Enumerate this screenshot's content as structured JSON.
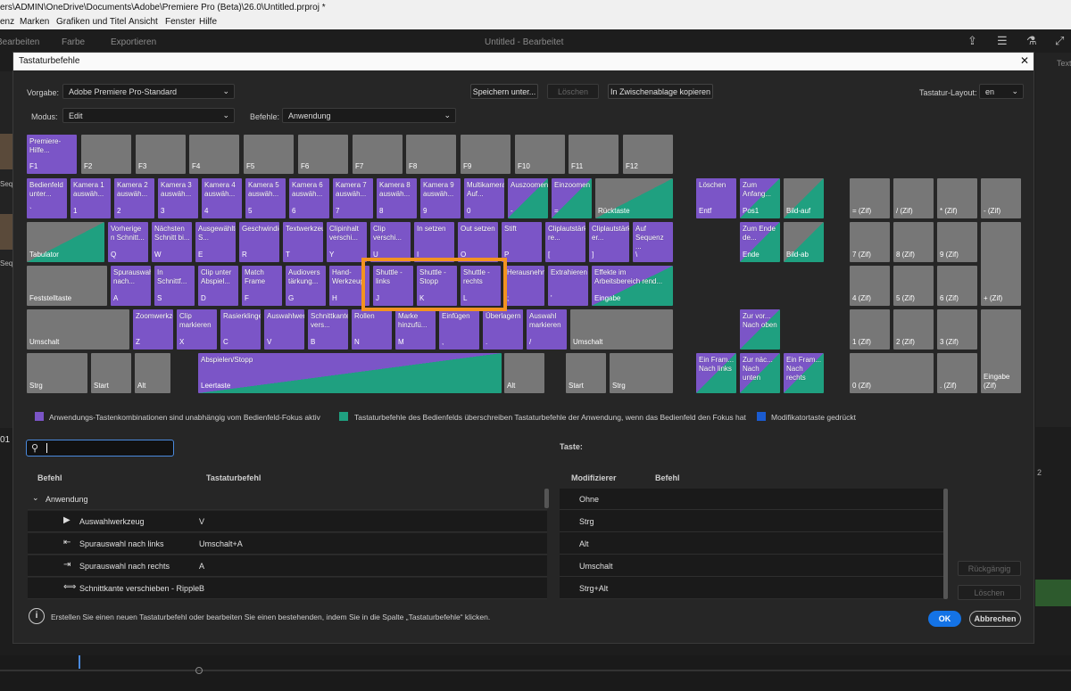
{
  "titlebar": {
    "text": "ers\\ADMIN\\OneDrive\\Documents\\Adobe\\Premiere Pro (Beta)\\26.0\\Untitled.prproj *"
  },
  "menubar": {
    "items": [
      "enz",
      "Marken",
      "Grafiken und Titel",
      "Ansicht",
      "Fenster",
      "Hilfe"
    ]
  },
  "workspace": {
    "tabs": [
      "Bearbeiten",
      "Farbe",
      "Exportieren"
    ],
    "project_title": "Untitled - Bearbeitet",
    "right_text": "Text"
  },
  "dialog": {
    "title": "Tastaturbefehle",
    "close": "✕"
  },
  "controls": {
    "preset_label": "Vorgabe:",
    "preset_value": "Adobe Premiere Pro-Standard",
    "save_btn": "Speichern unter...",
    "delete_btn": "Löschen",
    "clipboard_btn": "In Zwischenablage kopieren",
    "layout_label": "Tastatur-Layout:",
    "layout_value": "en",
    "mode_label": "Modus:",
    "mode_value": "Edit",
    "commands_label": "Befehle:",
    "commands_value": "Anwendung"
  },
  "keyboard": {
    "keys": [
      {
        "cmd": "Premiere-Hilfe...",
        "lab": "F1",
        "c": "p"
      },
      {
        "cmd": "",
        "lab": "F2",
        "c": ""
      },
      {
        "cmd": "",
        "lab": "F3",
        "c": ""
      },
      {
        "cmd": "",
        "lab": "F4",
        "c": ""
      },
      {
        "cmd": "",
        "lab": "F5",
        "c": ""
      },
      {
        "cmd": "",
        "lab": "F6",
        "c": ""
      },
      {
        "cmd": "",
        "lab": "F7",
        "c": ""
      },
      {
        "cmd": "",
        "lab": "F8",
        "c": ""
      },
      {
        "cmd": "",
        "lab": "F9",
        "c": ""
      },
      {
        "cmd": "",
        "lab": "F10",
        "c": ""
      },
      {
        "cmd": "",
        "lab": "F11",
        "c": ""
      },
      {
        "cmd": "",
        "lab": "F12",
        "c": ""
      },
      {
        "cmd": "Bedienfeld unter...",
        "lab": "`",
        "c": "p"
      },
      {
        "cmd": "Kamera 1 auswäh...",
        "lab": "1",
        "c": "p"
      },
      {
        "cmd": "Kamera 2 auswäh...",
        "lab": "2",
        "c": "p"
      },
      {
        "cmd": "Kamera 3 auswäh...",
        "lab": "3",
        "c": "p"
      },
      {
        "cmd": "Kamera 4 auswäh...",
        "lab": "4",
        "c": "p"
      },
      {
        "cmd": "Kamera 5 auswäh...",
        "lab": "5",
        "c": "p"
      },
      {
        "cmd": "Kamera 6 auswäh...",
        "lab": "6",
        "c": "p"
      },
      {
        "cmd": "Kamera 7 auswäh...",
        "lab": "7",
        "c": "p"
      },
      {
        "cmd": "Kamera 8 auswäh...",
        "lab": "8",
        "c": "p"
      },
      {
        "cmd": "Kamera 9 auswäh...",
        "lab": "9",
        "c": "p"
      },
      {
        "cmd": "Multikamera-Auf...",
        "lab": "0",
        "c": "p"
      },
      {
        "cmd": "Auszoomen",
        "lab": "-",
        "c": "pg"
      },
      {
        "cmd": "Einzoomen",
        "lab": "=",
        "c": "pg"
      },
      {
        "cmd": "",
        "lab": "Rücktaste",
        "c": "gg"
      },
      {
        "cmd": "",
        "lab": "Tabulator",
        "c": "gg"
      },
      {
        "cmd": "Vorherige n Schnitt...",
        "lab": "Q",
        "c": "p"
      },
      {
        "cmd": "Nächsten Schnitt bi...",
        "lab": "W",
        "c": "p"
      },
      {
        "cmd": "Ausgewählten S...",
        "lab": "E",
        "c": "p"
      },
      {
        "cmd": "Geschwindigkeit...",
        "lab": "R",
        "c": "p"
      },
      {
        "cmd": "Textwerkzeug",
        "lab": "T",
        "c": "p"
      },
      {
        "cmd": "Clipinhalt verschi...",
        "lab": "Y",
        "c": "p"
      },
      {
        "cmd": "Clip verschi...",
        "lab": "U",
        "c": "p"
      },
      {
        "cmd": "In setzen",
        "lab": "I",
        "c": "p"
      },
      {
        "cmd": "Out setzen",
        "lab": "O",
        "c": "p"
      },
      {
        "cmd": "Stift",
        "lab": "P",
        "c": "p"
      },
      {
        "cmd": "Cliplautstärke re...",
        "lab": "[",
        "c": "p"
      },
      {
        "cmd": "Cliplautstärke er...",
        "lab": "]",
        "c": "p"
      },
      {
        "cmd": "Auf Sequenz ...",
        "lab": "\\",
        "c": "p"
      },
      {
        "cmd": "",
        "lab": "Feststelltaste",
        "c": ""
      },
      {
        "cmd": "Spurauswahl nach...",
        "lab": "A",
        "c": "p"
      },
      {
        "cmd": "In Schnittf...",
        "lab": "S",
        "c": "p"
      },
      {
        "cmd": "Clip unter Abspiel...",
        "lab": "D",
        "c": "p"
      },
      {
        "cmd": "Match Frame",
        "lab": "F",
        "c": "p"
      },
      {
        "cmd": "Audiovers tärkung...",
        "lab": "G",
        "c": "p"
      },
      {
        "cmd": "Hand-Werkzeug",
        "lab": "H",
        "c": "p"
      },
      {
        "cmd": "Shuttle - links",
        "lab": "J",
        "c": "p"
      },
      {
        "cmd": "Shuttle - Stopp",
        "lab": "K",
        "c": "p"
      },
      {
        "cmd": "Shuttle - rechts",
        "lab": "L",
        "c": "p"
      },
      {
        "cmd": "Herausnehmen",
        "lab": ";",
        "c": "p"
      },
      {
        "cmd": "Extrahieren",
        "lab": "'",
        "c": "p"
      },
      {
        "cmd": "Effekte im Arbeitsbereich rend...",
        "lab": "Eingabe",
        "c": "pg"
      },
      {
        "cmd": "",
        "lab": "Umschalt",
        "c": ""
      },
      {
        "cmd": "Zoomwerkzeug",
        "lab": "Z",
        "c": "p"
      },
      {
        "cmd": "Clip markieren",
        "lab": "X",
        "c": "p"
      },
      {
        "cmd": "Rasierklinge",
        "lab": "C",
        "c": "p"
      },
      {
        "cmd": "Auswahlwerkzeug",
        "lab": "V",
        "c": "p"
      },
      {
        "cmd": "Schnittkante vers...",
        "lab": "B",
        "c": "p"
      },
      {
        "cmd": "Rollen",
        "lab": "N",
        "c": "p"
      },
      {
        "cmd": "Marke hinzufü...",
        "lab": "M",
        "c": "p"
      },
      {
        "cmd": "Einfügen",
        "lab": ",",
        "c": "p"
      },
      {
        "cmd": "Überlagern",
        "lab": ".",
        "c": "p"
      },
      {
        "cmd": "Auswahl markieren",
        "lab": "/",
        "c": "p"
      },
      {
        "cmd": "",
        "lab": "Umschalt",
        "c": ""
      },
      {
        "cmd": "",
        "lab": "Strg",
        "c": ""
      },
      {
        "cmd": "",
        "lab": "Start",
        "c": ""
      },
      {
        "cmd": "",
        "lab": "Alt",
        "c": ""
      },
      {
        "cmd": "Abspielen/Stopp",
        "lab": "Leertaste",
        "c": "pg"
      },
      {
        "cmd": "",
        "lab": "Alt",
        "c": ""
      },
      {
        "cmd": "",
        "lab": "Start",
        "c": ""
      },
      {
        "cmd": "",
        "lab": "Strg",
        "c": ""
      },
      {
        "cmd": "Löschen",
        "lab": "Entf",
        "c": "p"
      },
      {
        "cmd": "Zum Anfang...",
        "lab": "Pos1",
        "c": "pg"
      },
      {
        "cmd": "",
        "lab": "Bild-auf",
        "c": "gg"
      },
      {
        "cmd": "Zum Ende de...",
        "lab": "Ende",
        "c": "pg"
      },
      {
        "cmd": "",
        "lab": "Bild-ab",
        "c": "gg"
      },
      {
        "cmd": "Zur vor...\nNach oben",
        "lab": "",
        "c": "pg"
      },
      {
        "cmd": "Ein Fram...\nNach links",
        "lab": "",
        "c": "pg"
      },
      {
        "cmd": "Zur näc...\nNach unten",
        "lab": "",
        "c": "pg"
      },
      {
        "cmd": "Ein Fram...\nNach rechts",
        "lab": "",
        "c": "pg"
      },
      {
        "cmd": "",
        "lab": "= (Zif)",
        "c": ""
      },
      {
        "cmd": "",
        "lab": "/ (Zif)",
        "c": ""
      },
      {
        "cmd": "",
        "lab": "* (Zif)",
        "c": ""
      },
      {
        "cmd": "",
        "lab": "- (Zif)",
        "c": ""
      },
      {
        "cmd": "",
        "lab": "7 (Zif)",
        "c": ""
      },
      {
        "cmd": "",
        "lab": "8 (Zif)",
        "c": ""
      },
      {
        "cmd": "",
        "lab": "9 (Zif)",
        "c": ""
      },
      {
        "cmd": "",
        "lab": "4 (Zif)",
        "c": ""
      },
      {
        "cmd": "",
        "lab": "5 (Zif)",
        "c": ""
      },
      {
        "cmd": "",
        "lab": "6 (Zif)",
        "c": ""
      },
      {
        "cmd": "",
        "lab": "+ (Zif)",
        "c": ""
      },
      {
        "cmd": "",
        "lab": "1 (Zif)",
        "c": ""
      },
      {
        "cmd": "",
        "lab": "2 (Zif)",
        "c": ""
      },
      {
        "cmd": "",
        "lab": "3 (Zif)",
        "c": ""
      },
      {
        "cmd": "",
        "lab": "0 (Zif)",
        "c": ""
      },
      {
        "cmd": "",
        "lab": ". (Zif)",
        "c": ""
      },
      {
        "cmd": "",
        "lab": "Eingabe\n(Zif)",
        "c": ""
      }
    ]
  },
  "legend": {
    "app": "Anwendungs-Tastenkombinationen sind unabhängig vom Bedienfeld-Fokus aktiv",
    "panel": "Tastaturbefehle des Bedienfelds überschreiben Tastaturbefehle der Anwendung, wenn das Bedienfeld den Fokus hat",
    "modifier": "Modifikatortaste gedrückt",
    "colors": {
      "app": "#7b55c7",
      "panel": "#1fa080",
      "modifier": "#1a5bd0"
    }
  },
  "search": {
    "value": "",
    "placeholder": ""
  },
  "key_label": "Taste:",
  "table": {
    "col_command": "Befehl",
    "col_shortcut": "Tastaturbefehl",
    "group": "Anwendung",
    "rows": [
      {
        "icon": "selection-tool-icon",
        "glyph": "▶",
        "name": "Auswahlwerkzeug",
        "shortcut": "V"
      },
      {
        "icon": "track-select-backward-icon",
        "glyph": "⇤",
        "name": "Spurauswahl nach links",
        "shortcut": "Umschalt+A"
      },
      {
        "icon": "track-select-forward-icon",
        "glyph": "⇥",
        "name": "Spurauswahl nach rechts",
        "shortcut": "A"
      },
      {
        "icon": "ripple-edit-icon",
        "glyph": "⟺",
        "name": "Schnittkante verschieben - Ripple",
        "shortcut": "B"
      }
    ]
  },
  "modtable": {
    "col_modifier": "Modifizierer",
    "col_command": "Befehl",
    "rows": [
      "Ohne",
      "Strg",
      "Alt",
      "Umschalt",
      "Strg+Alt"
    ]
  },
  "side_buttons": {
    "undo": "Rückgängig",
    "delete": "Löschen"
  },
  "footer": {
    "info": "Erstellen Sie einen neuen Tastaturbefehl oder bearbeiten Sie einen bestehenden, indem Sie in die Spalte „Tastaturbefehle“ klicken.",
    "ok": "OK",
    "cancel": "Abbrechen"
  },
  "background": {
    "seq1": "Seq",
    "seq2": "Seq",
    "timecode": "01",
    "ruler": "2"
  }
}
